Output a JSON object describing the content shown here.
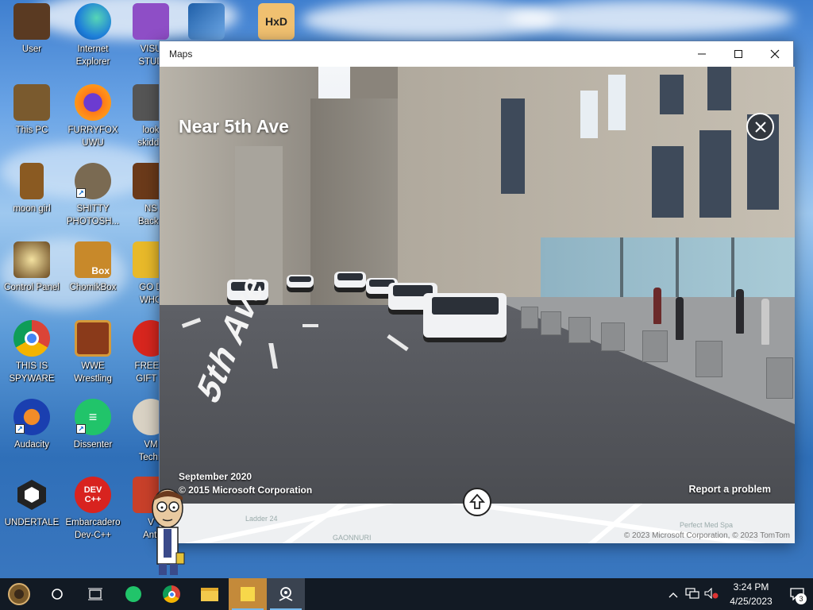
{
  "desktop": {
    "icons": [
      {
        "label": "User"
      },
      {
        "label": "Internet\nExplorer"
      },
      {
        "label": "VISU\nSTUD"
      },
      {
        "label": "This PC"
      },
      {
        "label": "FURRYFOX\nUWU"
      },
      {
        "label": "look\nskidde"
      },
      {
        "label": "moon girl"
      },
      {
        "label": "SHITTY\nPHOTOSH..."
      },
      {
        "label": "NS\nBacko"
      },
      {
        "label": "Control Panel"
      },
      {
        "label": "ChomikBox"
      },
      {
        "label": "GO D\nWHO"
      },
      {
        "label": "THIS IS\nSPYWARE"
      },
      {
        "label": "WWE\nWrestling"
      },
      {
        "label": "FREE A\nGIFT C"
      },
      {
        "label": "Audacity"
      },
      {
        "label": "Dissenter"
      },
      {
        "label": "VM\nTechn"
      },
      {
        "label": "UNDERTALE"
      },
      {
        "label": "Embarcadero\nDev-C++"
      },
      {
        "label": "V\nAnti"
      }
    ],
    "icon_texts": {
      "chomik": "Box",
      "devcpp": "DEV\nC++",
      "hxd": "HxD"
    }
  },
  "window": {
    "title": "Maps",
    "street_title": "Near 5th Ave",
    "date": "September 2020",
    "copyright": "© 2015 Microsoft Corporation",
    "report": "Report a problem",
    "avenue_sign": "5th Ave",
    "map_copyright": "© 2023 Microsoft Corporation, © 2023 TomTom",
    "map_labels": [
      "Ladder 24",
      "Perfect Med Spa",
      "GAONNURI"
    ]
  },
  "taskbar": {
    "time": "3:24 PM",
    "date": "4/25/2023",
    "notification_count": "3"
  }
}
